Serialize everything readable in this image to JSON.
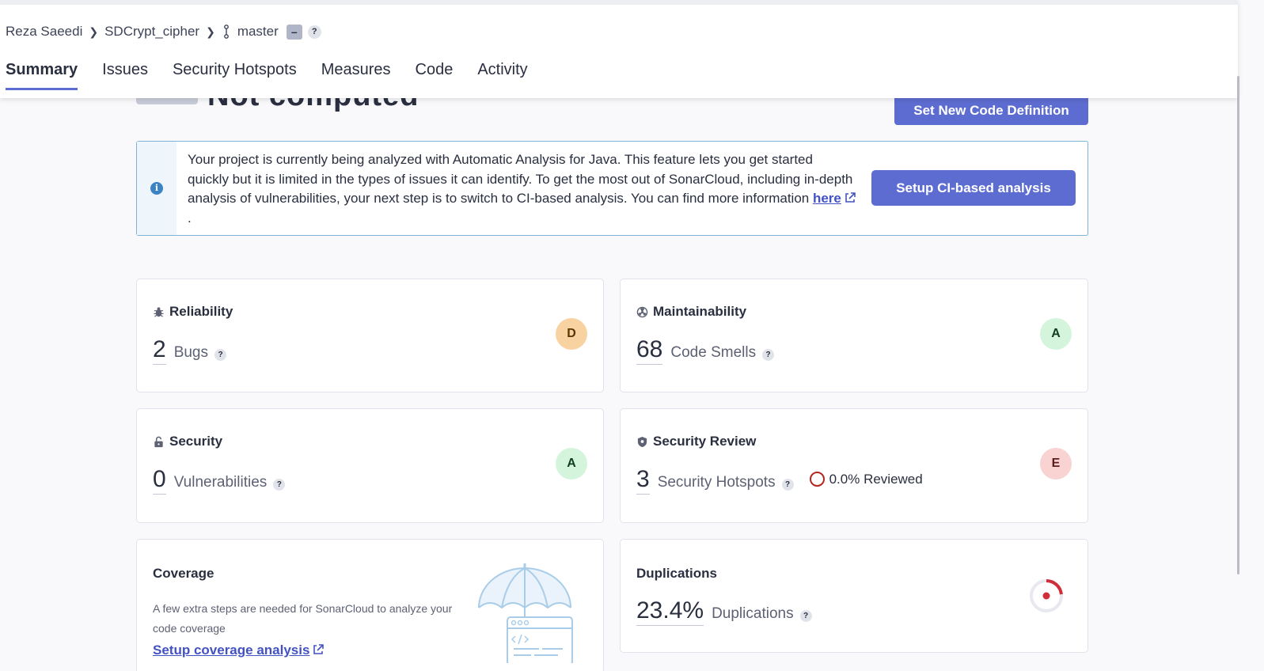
{
  "breadcrumb": {
    "organization": "Reza Saeedi",
    "project": "SDCrypt_cipher",
    "branch": "master",
    "branch_badge": "–",
    "help": "?"
  },
  "tabs": [
    {
      "label": "Summary",
      "active": true
    },
    {
      "label": "Issues"
    },
    {
      "label": "Security Hotspots"
    },
    {
      "label": "Measures"
    },
    {
      "label": "Code"
    },
    {
      "label": "Activity"
    }
  ],
  "new_code": {
    "title": "Not computed",
    "button": "Set New Code Definition"
  },
  "banner": {
    "text": "Your project is currently being analyzed with Automatic Analysis for Java. This feature lets you get started quickly but it is limited in the types of issues it can identify. To get the most out of SonarCloud, including in-depth analysis of vulnerabilities, your next step is to switch to CI-based analysis. You can find more information ",
    "link": "here",
    "suffix": ".",
    "button": "Setup CI-based analysis"
  },
  "cards": {
    "reliability": {
      "title": "Reliability",
      "value": "2",
      "label": "Bugs",
      "rating": "D",
      "rating_bg": "#f9d2a2",
      "rating_fg": "#5b3700",
      "icon": "bug-icon"
    },
    "maintainability": {
      "title": "Maintainability",
      "value": "68",
      "label": "Code Smells",
      "rating": "A",
      "rating_bg": "#d4f5dc",
      "rating_fg": "#123d1f",
      "icon": "radiation-icon"
    },
    "security": {
      "title": "Security",
      "value": "0",
      "label": "Vulnerabilities",
      "rating": "A",
      "rating_bg": "#d4f5dc",
      "rating_fg": "#123d1f",
      "icon": "lock-icon"
    },
    "security_review": {
      "title": "Security Review",
      "value": "3",
      "label": "Security Hotspots",
      "reviewed": "0.0% Reviewed",
      "rating": "E",
      "rating_bg": "#f9d2d2",
      "rating_fg": "#5e1b1b",
      "icon": "shield-icon"
    },
    "coverage": {
      "title": "Coverage",
      "text": "A few extra steps are needed for SonarCloud to analyze your code coverage",
      "link": "Setup coverage analysis"
    },
    "duplications": {
      "title": "Duplications",
      "value": "23.4%",
      "label": "Duplications",
      "percent": 23.4
    }
  },
  "help_glyph": "?",
  "info_glyph": "i"
}
